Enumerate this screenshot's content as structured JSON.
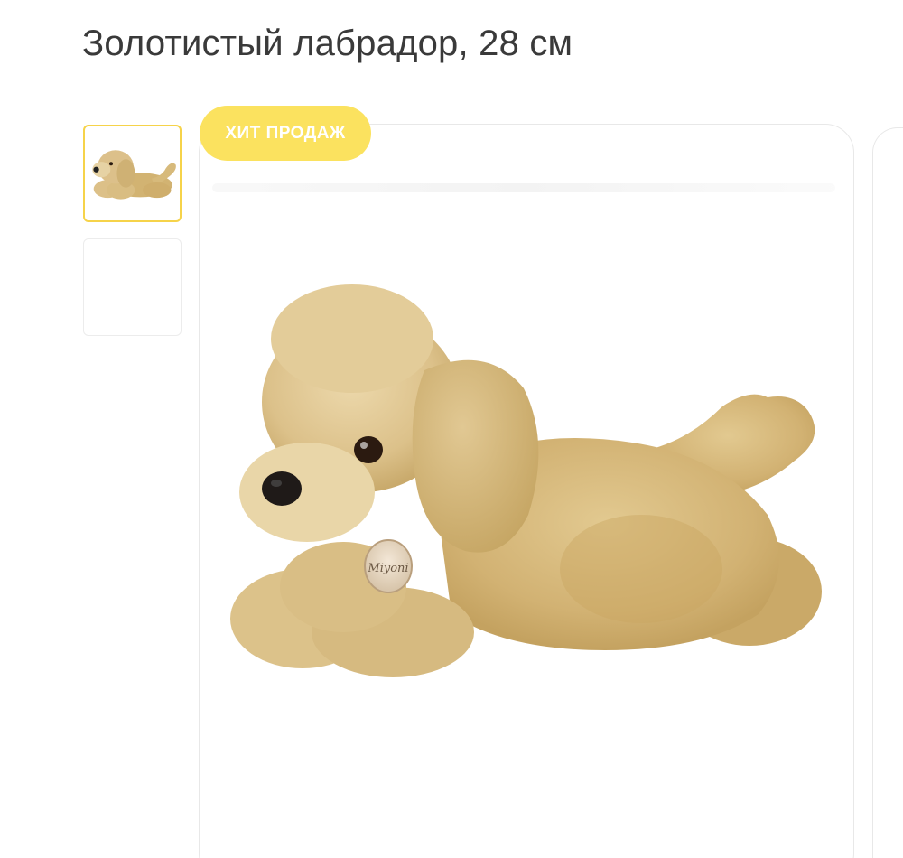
{
  "product": {
    "title": "Золотистый лабрадор, 28 см",
    "badge": "ХИТ ПРОДАЖ"
  },
  "gallery": {
    "thumbnails": [
      {
        "label": "thumbnail-1",
        "active": true,
        "image": "plush-labrador"
      },
      {
        "label": "thumbnail-2",
        "active": false,
        "image": "blank"
      }
    ],
    "main_image": "plush-labrador",
    "tag_text": "Miyoni"
  },
  "colors": {
    "badge": "#fbe25f",
    "active_thumb_border": "#f6d34a",
    "plush_fur": "#d8bb7c"
  }
}
